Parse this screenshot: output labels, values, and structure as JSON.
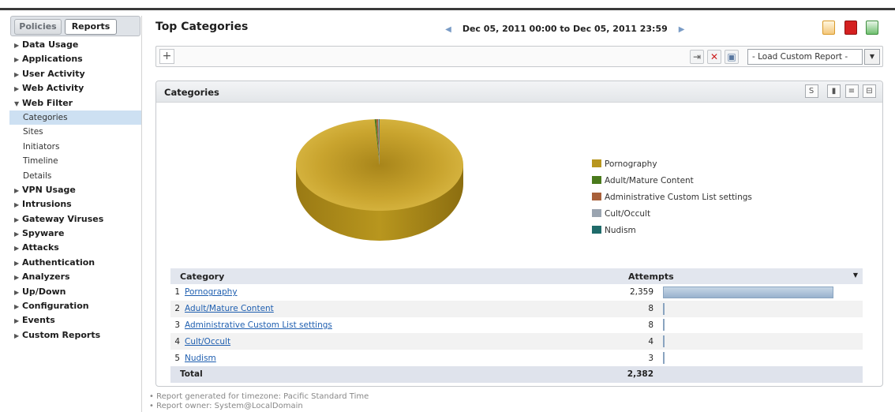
{
  "sidebar": {
    "tabs": [
      "Policies",
      "Reports"
    ],
    "active_tab": "Reports",
    "items": [
      {
        "label": "Data Usage",
        "type": "group",
        "expanded": false
      },
      {
        "label": "Applications",
        "type": "group",
        "expanded": false
      },
      {
        "label": "User Activity",
        "type": "group",
        "expanded": false
      },
      {
        "label": "Web Activity",
        "type": "group",
        "expanded": false
      },
      {
        "label": "Web Filter",
        "type": "group",
        "expanded": true
      },
      {
        "label": "Categories",
        "type": "sub",
        "selected": true
      },
      {
        "label": "Sites",
        "type": "sub"
      },
      {
        "label": "Initiators",
        "type": "sub"
      },
      {
        "label": "Timeline",
        "type": "sub"
      },
      {
        "label": "Details",
        "type": "sub"
      },
      {
        "label": "VPN Usage",
        "type": "group",
        "expanded": false
      },
      {
        "label": "Intrusions",
        "type": "group",
        "expanded": false
      },
      {
        "label": "Gateway Viruses",
        "type": "group",
        "expanded": false
      },
      {
        "label": "Spyware",
        "type": "group",
        "expanded": false
      },
      {
        "label": "Attacks",
        "type": "group",
        "expanded": false
      },
      {
        "label": "Authentication",
        "type": "group",
        "expanded": false
      },
      {
        "label": "Analyzers",
        "type": "group",
        "expanded": false
      },
      {
        "label": "Up/Down",
        "type": "group",
        "expanded": false
      },
      {
        "label": "Configuration",
        "type": "group",
        "expanded": false
      },
      {
        "label": "Events",
        "type": "group",
        "expanded": false
      },
      {
        "label": "Custom Reports",
        "type": "group",
        "expanded": false
      }
    ]
  },
  "header": {
    "title": "Top Categories",
    "date_range": "Dec 05, 2011 00:00 to Dec 05, 2011 23:59",
    "export_icons": [
      "rtf-export-icon",
      "pdf-export-icon",
      "excel-export-icon"
    ]
  },
  "filter_bar": {
    "add_symbol": "+",
    "custom_report_select": "- Load Custom Report -"
  },
  "panel": {
    "title": "Categories",
    "chart_data": {
      "type": "pie",
      "labels": [
        "Pornography",
        "Adult/Mature Content",
        "Administrative Custom List settings",
        "Cult/Occult",
        "Nudism"
      ],
      "values": [
        2359,
        8,
        8,
        4,
        3
      ],
      "colors": [
        "#b8961e",
        "#4a7a1c",
        "#a8603a",
        "#9aa4b0",
        "#1f6b6a"
      ]
    },
    "table": {
      "headers": {
        "category": "Category",
        "attempts": "Attempts"
      },
      "rows": [
        {
          "rank": "1",
          "category": "Pornography",
          "attempts": "2,359"
        },
        {
          "rank": "2",
          "category": "Adult/Mature Content",
          "attempts": "8"
        },
        {
          "rank": "3",
          "category": "Administrative Custom List settings",
          "attempts": "8"
        },
        {
          "rank": "4",
          "category": "Cult/Occult",
          "attempts": "4"
        },
        {
          "rank": "5",
          "category": "Nudism",
          "attempts": "3"
        }
      ],
      "bar_fraction": [
        1.0,
        0.0034,
        0.0034,
        0.0017,
        0.0013
      ],
      "total_label": "Total",
      "total_value": "2,382"
    }
  },
  "footer": {
    "line1": "• Report generated for timezone: Pacific Standard Time",
    "line2": "• Report owner: System@LocalDomain"
  }
}
